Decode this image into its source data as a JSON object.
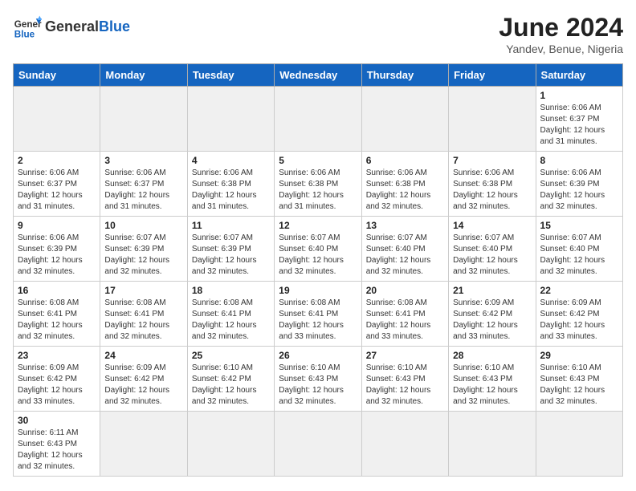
{
  "header": {
    "logo_general": "General",
    "logo_blue": "Blue",
    "title": "June 2024",
    "subtitle": "Yandev, Benue, Nigeria"
  },
  "days_of_week": [
    "Sunday",
    "Monday",
    "Tuesday",
    "Wednesday",
    "Thursday",
    "Friday",
    "Saturday"
  ],
  "weeks": [
    [
      {
        "day": "",
        "info": ""
      },
      {
        "day": "",
        "info": ""
      },
      {
        "day": "",
        "info": ""
      },
      {
        "day": "",
        "info": ""
      },
      {
        "day": "",
        "info": ""
      },
      {
        "day": "",
        "info": ""
      },
      {
        "day": "1",
        "info": "Sunrise: 6:06 AM\nSunset: 6:37 PM\nDaylight: 12 hours\nand 31 minutes."
      }
    ],
    [
      {
        "day": "2",
        "info": "Sunrise: 6:06 AM\nSunset: 6:37 PM\nDaylight: 12 hours\nand 31 minutes."
      },
      {
        "day": "3",
        "info": "Sunrise: 6:06 AM\nSunset: 6:37 PM\nDaylight: 12 hours\nand 31 minutes."
      },
      {
        "day": "4",
        "info": "Sunrise: 6:06 AM\nSunset: 6:38 PM\nDaylight: 12 hours\nand 31 minutes."
      },
      {
        "day": "5",
        "info": "Sunrise: 6:06 AM\nSunset: 6:38 PM\nDaylight: 12 hours\nand 31 minutes."
      },
      {
        "day": "6",
        "info": "Sunrise: 6:06 AM\nSunset: 6:38 PM\nDaylight: 12 hours\nand 32 minutes."
      },
      {
        "day": "7",
        "info": "Sunrise: 6:06 AM\nSunset: 6:38 PM\nDaylight: 12 hours\nand 32 minutes."
      },
      {
        "day": "8",
        "info": "Sunrise: 6:06 AM\nSunset: 6:39 PM\nDaylight: 12 hours\nand 32 minutes."
      }
    ],
    [
      {
        "day": "9",
        "info": "Sunrise: 6:06 AM\nSunset: 6:39 PM\nDaylight: 12 hours\nand 32 minutes."
      },
      {
        "day": "10",
        "info": "Sunrise: 6:07 AM\nSunset: 6:39 PM\nDaylight: 12 hours\nand 32 minutes."
      },
      {
        "day": "11",
        "info": "Sunrise: 6:07 AM\nSunset: 6:39 PM\nDaylight: 12 hours\nand 32 minutes."
      },
      {
        "day": "12",
        "info": "Sunrise: 6:07 AM\nSunset: 6:40 PM\nDaylight: 12 hours\nand 32 minutes."
      },
      {
        "day": "13",
        "info": "Sunrise: 6:07 AM\nSunset: 6:40 PM\nDaylight: 12 hours\nand 32 minutes."
      },
      {
        "day": "14",
        "info": "Sunrise: 6:07 AM\nSunset: 6:40 PM\nDaylight: 12 hours\nand 32 minutes."
      },
      {
        "day": "15",
        "info": "Sunrise: 6:07 AM\nSunset: 6:40 PM\nDaylight: 12 hours\nand 32 minutes."
      }
    ],
    [
      {
        "day": "16",
        "info": "Sunrise: 6:08 AM\nSunset: 6:41 PM\nDaylight: 12 hours\nand 32 minutes."
      },
      {
        "day": "17",
        "info": "Sunrise: 6:08 AM\nSunset: 6:41 PM\nDaylight: 12 hours\nand 32 minutes."
      },
      {
        "day": "18",
        "info": "Sunrise: 6:08 AM\nSunset: 6:41 PM\nDaylight: 12 hours\nand 32 minutes."
      },
      {
        "day": "19",
        "info": "Sunrise: 6:08 AM\nSunset: 6:41 PM\nDaylight: 12 hours\nand 33 minutes."
      },
      {
        "day": "20",
        "info": "Sunrise: 6:08 AM\nSunset: 6:41 PM\nDaylight: 12 hours\nand 33 minutes."
      },
      {
        "day": "21",
        "info": "Sunrise: 6:09 AM\nSunset: 6:42 PM\nDaylight: 12 hours\nand 33 minutes."
      },
      {
        "day": "22",
        "info": "Sunrise: 6:09 AM\nSunset: 6:42 PM\nDaylight: 12 hours\nand 33 minutes."
      }
    ],
    [
      {
        "day": "23",
        "info": "Sunrise: 6:09 AM\nSunset: 6:42 PM\nDaylight: 12 hours\nand 33 minutes."
      },
      {
        "day": "24",
        "info": "Sunrise: 6:09 AM\nSunset: 6:42 PM\nDaylight: 12 hours\nand 32 minutes."
      },
      {
        "day": "25",
        "info": "Sunrise: 6:10 AM\nSunset: 6:42 PM\nDaylight: 12 hours\nand 32 minutes."
      },
      {
        "day": "26",
        "info": "Sunrise: 6:10 AM\nSunset: 6:43 PM\nDaylight: 12 hours\nand 32 minutes."
      },
      {
        "day": "27",
        "info": "Sunrise: 6:10 AM\nSunset: 6:43 PM\nDaylight: 12 hours\nand 32 minutes."
      },
      {
        "day": "28",
        "info": "Sunrise: 6:10 AM\nSunset: 6:43 PM\nDaylight: 12 hours\nand 32 minutes."
      },
      {
        "day": "29",
        "info": "Sunrise: 6:10 AM\nSunset: 6:43 PM\nDaylight: 12 hours\nand 32 minutes."
      }
    ],
    [
      {
        "day": "30",
        "info": "Sunrise: 6:11 AM\nSunset: 6:43 PM\nDaylight: 12 hours\nand 32 minutes."
      },
      {
        "day": "",
        "info": ""
      },
      {
        "day": "",
        "info": ""
      },
      {
        "day": "",
        "info": ""
      },
      {
        "day": "",
        "info": ""
      },
      {
        "day": "",
        "info": ""
      },
      {
        "day": "",
        "info": ""
      }
    ]
  ]
}
